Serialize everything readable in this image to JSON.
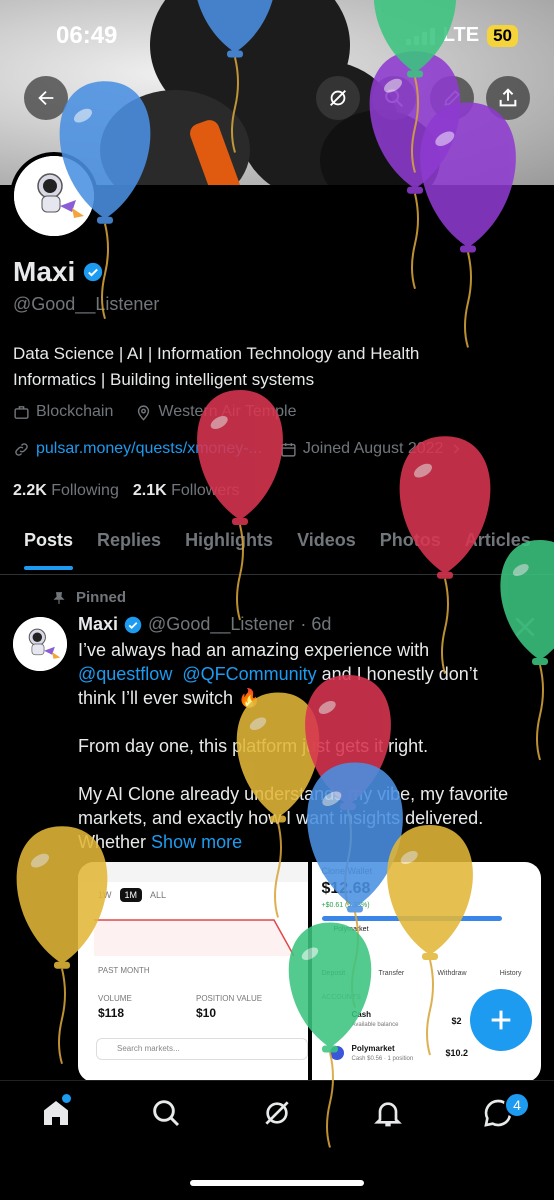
{
  "status_bar": {
    "time": "06:49",
    "network": "LTE",
    "battery": "50"
  },
  "profile": {
    "name": "Maxi",
    "handle": "@Good__Listener",
    "bio_line1": "Data Science | AI | Information Technology and Health",
    "bio_line2": "Informatics | Building intelligent systems",
    "category": "Blockchain",
    "location": "Western Air Temple",
    "link": "pulsar.money/quests/xmoney-...",
    "joined": "Joined August 2022",
    "following_count": "2.2K",
    "following_label": "Following",
    "followers_count": "2.1K",
    "followers_label": "Followers"
  },
  "tabs": [
    "Posts",
    "Replies",
    "Highlights",
    "Videos",
    "Photos",
    "Articles"
  ],
  "post": {
    "pinned_label": "Pinned",
    "author": "Maxi",
    "handle": "@Good__Listener",
    "age": "· 6d",
    "line1": "I’ve always had an amazing experience with",
    "mention1": "@questflow",
    "mention2": "@QFCommunity",
    "line2_tail": " and I honestly don’t",
    "line3": "think I’ll ever switch 🔥",
    "para2": "From day one, this platform just gets it right.",
    "para3_line1": "My AI Clone already understands my vibe, my favorite",
    "para3_line2": "markets, and exactly how I want insights delivered.",
    "para3_line3": "Whether",
    "show_more": "Show more"
  },
  "media_left": {
    "range_1w": "1W",
    "range_1m": "1M",
    "range_all": "ALL",
    "past_month": "PAST MONTH",
    "volume_label": "VOLUME",
    "volume_value": "$118",
    "position_label": "POSITION VALUE",
    "position_value": "$10",
    "search_placeholder": "Search markets..."
  },
  "media_right": {
    "title": "Clone Wallet",
    "balance": "$12.68",
    "change": "+$0.61 (5.33%)",
    "polymarket_top": "Polymarket",
    "action_deposit": "Deposit",
    "action_transfer": "Transfer",
    "action_withdraw": "Withdraw",
    "action_history": "History",
    "accounts_label": "ACCOUNTS",
    "cash_label": "Cash",
    "cash_sub": "Available balance",
    "cash_value": "$2",
    "poly_label": "Polymarket",
    "poly_sub": "Cash $0.56 · 1 position",
    "poly_value": "$10.2"
  },
  "nav": {
    "notification_count": "4"
  },
  "colors": {
    "accent": "#1d9bf0",
    "background": "#000000",
    "muted": "#71767b"
  },
  "balloon_colors": [
    "#4a90e2",
    "#8e3bd0",
    "#d93550",
    "#e2b83a",
    "#3cc47f"
  ]
}
